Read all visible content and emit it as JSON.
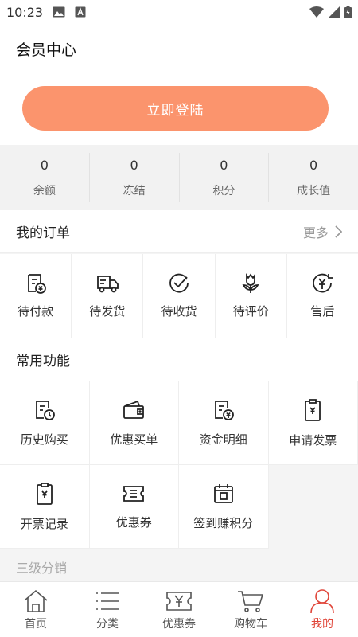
{
  "status_bar": {
    "time": "10:23"
  },
  "header": {
    "title": "会员中心",
    "login_label": "立即登陆"
  },
  "stats": [
    {
      "value": "0",
      "label": "余额"
    },
    {
      "value": "0",
      "label": "冻结"
    },
    {
      "value": "0",
      "label": "积分"
    },
    {
      "value": "0",
      "label": "成长值"
    }
  ],
  "orders": {
    "title": "我的订单",
    "more_label": "更多",
    "items": [
      {
        "label": "待付款",
        "icon": "wallet-icon"
      },
      {
        "label": "待发货",
        "icon": "truck-icon"
      },
      {
        "label": "待收货",
        "icon": "check-circle-icon"
      },
      {
        "label": "待评价",
        "icon": "flower-icon"
      },
      {
        "label": "售后",
        "icon": "refund-icon"
      }
    ]
  },
  "functions": {
    "title": "常用功能",
    "items": [
      {
        "label": "历史购买",
        "icon": "history-icon"
      },
      {
        "label": "优惠买单",
        "icon": "wallet-card-icon"
      },
      {
        "label": "资金明细",
        "icon": "bill-icon"
      },
      {
        "label": "申请发票",
        "icon": "invoice-icon"
      },
      {
        "label": "开票记录",
        "icon": "invoice-record-icon"
      },
      {
        "label": "优惠券",
        "icon": "ticket-icon"
      },
      {
        "label": "签到赚积分",
        "icon": "calendar-icon"
      }
    ]
  },
  "distribution": {
    "title": "三级分销"
  },
  "tabbar": {
    "items": [
      {
        "label": "首页",
        "icon": "home-icon"
      },
      {
        "label": "分类",
        "icon": "list-icon"
      },
      {
        "label": "优惠券",
        "icon": "coupon-icon"
      },
      {
        "label": "购物车",
        "icon": "cart-icon"
      },
      {
        "label": "我的",
        "icon": "user-icon",
        "active": true
      }
    ]
  },
  "colors": {
    "accent": "#fb946d",
    "active_tab": "#e0463a"
  }
}
